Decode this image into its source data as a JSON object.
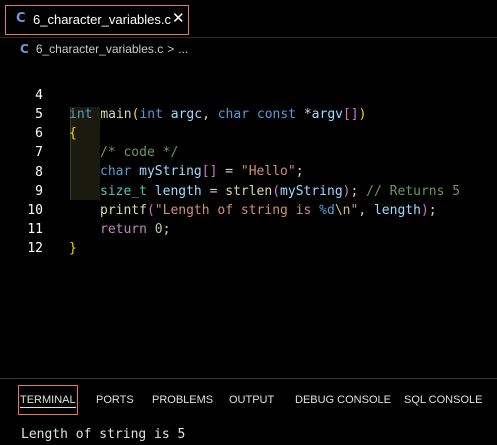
{
  "tab": {
    "icon_letter": "C",
    "label": "6_character_variables.c",
    "close_glyph": "✕"
  },
  "breadcrumb": {
    "icon_letter": "C",
    "file": "6_character_variables.c",
    "separator": ">",
    "more": "..."
  },
  "editor": {
    "line_numbers": [
      "4",
      "5",
      "6",
      "7",
      "8",
      "9",
      "10",
      "11",
      "12"
    ],
    "lines": {
      "l4": [
        {
          "t": "int",
          "c": "kw"
        },
        {
          "t": " ",
          "c": "plain"
        },
        {
          "t": "main",
          "c": "fn"
        },
        {
          "t": "(",
          "c": "br1"
        },
        {
          "t": "int",
          "c": "kw"
        },
        {
          "t": " ",
          "c": "plain"
        },
        {
          "t": "argc",
          "c": "var"
        },
        {
          "t": ", ",
          "c": "plain"
        },
        {
          "t": "char",
          "c": "kw"
        },
        {
          "t": " ",
          "c": "plain"
        },
        {
          "t": "const",
          "c": "kw"
        },
        {
          "t": " *",
          "c": "plain"
        },
        {
          "t": "argv",
          "c": "var"
        },
        {
          "t": "[]",
          "c": "br2"
        },
        {
          "t": ")",
          "c": "br1"
        }
      ],
      "l5": [
        {
          "t": "{",
          "c": "br1"
        }
      ],
      "l6": [
        {
          "t": "/* code */",
          "c": "com"
        }
      ],
      "l7": [
        {
          "t": "char",
          "c": "kw"
        },
        {
          "t": " ",
          "c": "plain"
        },
        {
          "t": "myString",
          "c": "var"
        },
        {
          "t": "[]",
          "c": "br2"
        },
        {
          "t": " = ",
          "c": "plain"
        },
        {
          "t": "\"Hello\"",
          "c": "str"
        },
        {
          "t": ";",
          "c": "plain"
        }
      ],
      "l8": [
        {
          "t": "size_t",
          "c": "ty"
        },
        {
          "t": " ",
          "c": "plain"
        },
        {
          "t": "length",
          "c": "var"
        },
        {
          "t": " = ",
          "c": "plain"
        },
        {
          "t": "strlen",
          "c": "fn"
        },
        {
          "t": "(",
          "c": "br2"
        },
        {
          "t": "myString",
          "c": "var"
        },
        {
          "t": ")",
          "c": "br2"
        },
        {
          "t": "; ",
          "c": "plain"
        },
        {
          "t": "// Returns 5",
          "c": "com"
        }
      ],
      "l9": [
        {
          "t": "printf",
          "c": "fn"
        },
        {
          "t": "(",
          "c": "br2"
        },
        {
          "t": "\"Length of string is ",
          "c": "str"
        },
        {
          "t": "%d",
          "c": "kw"
        },
        {
          "t": "\\n",
          "c": "esc"
        },
        {
          "t": "\"",
          "c": "str"
        },
        {
          "t": ", ",
          "c": "plain"
        },
        {
          "t": "length",
          "c": "var"
        },
        {
          "t": ")",
          "c": "br2"
        },
        {
          "t": ";",
          "c": "plain"
        }
      ],
      "l10": [
        {
          "t": "return",
          "c": "ctl"
        },
        {
          "t": " ",
          "c": "plain"
        },
        {
          "t": "0",
          "c": "num"
        },
        {
          "t": ";",
          "c": "plain"
        }
      ],
      "l11": [
        {
          "t": "}",
          "c": "br1"
        }
      ],
      "l12": []
    }
  },
  "panel": {
    "tabs": [
      "TERMINAL",
      "PORTS",
      "PROBLEMS",
      "OUTPUT",
      "DEBUG CONSOLE",
      "SQL CONSOLE"
    ],
    "active_tab": "TERMINAL",
    "terminal_output": "Length of string is 5"
  },
  "colors": {
    "tab_border": "#e07b53",
    "c_icon": "#6e9bd6",
    "background": "#000000"
  }
}
